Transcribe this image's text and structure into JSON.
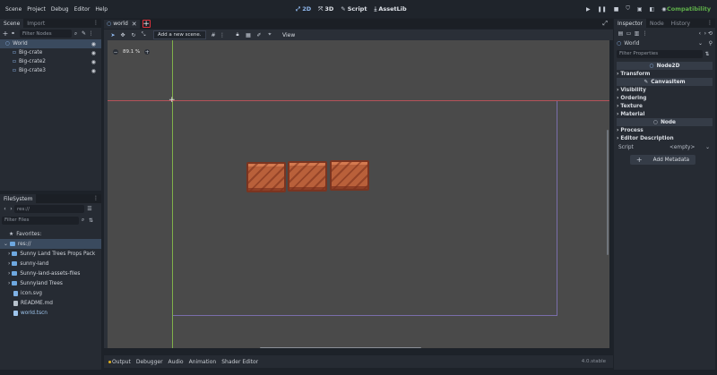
{
  "menu": [
    "Scene",
    "Project",
    "Debug",
    "Editor",
    "Help"
  ],
  "workspaces": [
    {
      "label": "2D",
      "icon": "2d-icon",
      "active": true
    },
    {
      "label": "3D",
      "icon": "3d-icon",
      "active": false
    },
    {
      "label": "Script",
      "icon": "script-icon",
      "active": false
    },
    {
      "label": "AssetLib",
      "icon": "assetlib-icon",
      "active": false
    }
  ],
  "renderer": "Compatibility",
  "scene_dock": {
    "tabs": [
      "Scene",
      "Import"
    ],
    "filter_placeholder": "Filter Nodes",
    "nodes": [
      {
        "name": "World",
        "selected": true,
        "root": true
      },
      {
        "name": "Big-crate",
        "selected": false
      },
      {
        "name": "Big-crate2",
        "selected": false
      },
      {
        "name": "Big-crate3",
        "selected": false
      }
    ]
  },
  "filesystem": {
    "tab": "FileSystem",
    "path": "res://",
    "filter_placeholder": "Filter Files",
    "favorites": "Favorites:",
    "root": "res://",
    "items": [
      {
        "name": "Sunny Land Trees Props Pack",
        "type": "folder"
      },
      {
        "name": "sunny-land",
        "type": "folder"
      },
      {
        "name": "Sunny-land-assets-files",
        "type": "folder"
      },
      {
        "name": "Sunnyland Trees",
        "type": "folder"
      },
      {
        "name": "icon.svg",
        "type": "file"
      },
      {
        "name": "README.md",
        "type": "file"
      },
      {
        "name": "world.tscn",
        "type": "scene"
      }
    ]
  },
  "editor": {
    "scene_tab": "world",
    "tooltip": "Add a new scene.",
    "view_menu": "View",
    "zoom": "89.1 %"
  },
  "bottom": {
    "tabs": [
      "Output",
      "Debugger",
      "Audio",
      "Animation",
      "Shader Editor"
    ],
    "version": "4.0.stable"
  },
  "inspector": {
    "tabs": [
      "Inspector",
      "Node",
      "History"
    ],
    "object": "World",
    "filter_placeholder": "Filter Properties",
    "sections": [
      {
        "kind": "header",
        "label": "Node2D"
      },
      {
        "kind": "row",
        "label": "Transform"
      },
      {
        "kind": "header",
        "label": "CanvasItem"
      },
      {
        "kind": "row",
        "label": "Visibility"
      },
      {
        "kind": "row",
        "label": "Ordering"
      },
      {
        "kind": "row",
        "label": "Texture"
      },
      {
        "kind": "row",
        "label": "Material"
      },
      {
        "kind": "header",
        "label": "Node"
      },
      {
        "kind": "row",
        "label": "Process"
      },
      {
        "kind": "row",
        "label": "Editor Description"
      }
    ],
    "script_label": "Script",
    "script_value": "<empty>",
    "add_metadata": "Add Metadata"
  },
  "colors": {
    "accent": "#6ea8e0",
    "renderer": "#5fb04a",
    "selection": "#3a4a5e",
    "close_highlight": "#e0303a"
  }
}
